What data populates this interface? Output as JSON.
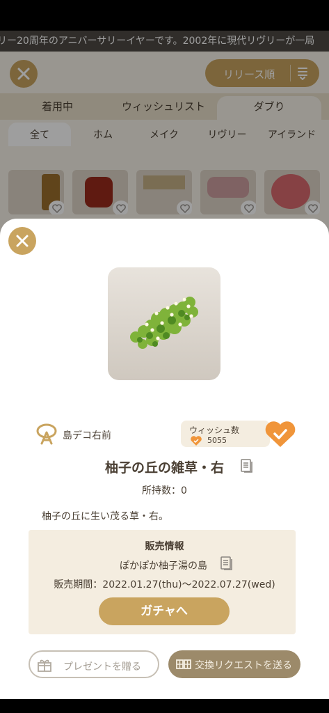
{
  "marquee": {
    "text": "リー20周年のアニバーサリーイヤーです。2002年に現代リヴリーが一局"
  },
  "sort": {
    "label": "リリース順"
  },
  "tabs": [
    {
      "label": "着用中"
    },
    {
      "label": "ウィッシュリスト"
    },
    {
      "label": "ダブり"
    }
  ],
  "subtabs": [
    {
      "label": "全て"
    },
    {
      "label": "ホム"
    },
    {
      "label": "メイク"
    },
    {
      "label": "リヴリー"
    },
    {
      "label": "アイランド"
    }
  ],
  "item": {
    "category": "島デコ右前",
    "wish_title": "ウィッシュ数",
    "wish_count": "5055",
    "name": "柚子の丘の雑草・右",
    "owned": "所持数：0",
    "description": "柚子の丘に生い茂る草・右。"
  },
  "sale": {
    "title": "販売情報",
    "place": "ぽかぽか柚子湯の島",
    "period": "販売期間：2022.01.27(thu)〜2022.07.27(wed)",
    "button": "ガチャへ"
  },
  "actions": {
    "present": "プレゼントを贈る",
    "trade": "交換リクエストを送る"
  },
  "colors": {
    "accent": "#c9a45f",
    "wish_orange": "#f0953a"
  }
}
